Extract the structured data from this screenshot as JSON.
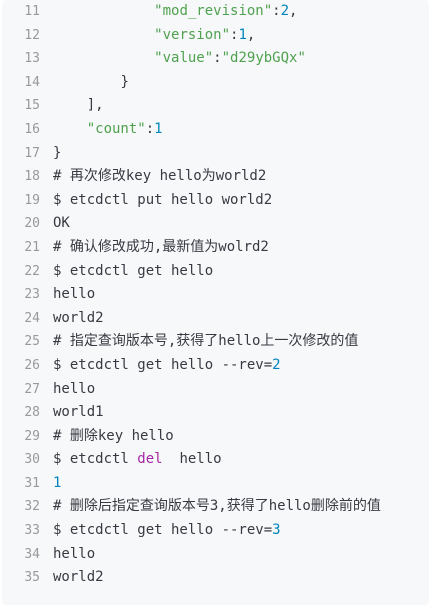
{
  "editor": {
    "colors": {
      "background": "#f6f8fa",
      "line_number": "#999999",
      "plain": "#383a42",
      "string": "#50a14f",
      "number": "#0184bc",
      "keyword": "#a626a4"
    },
    "lines": [
      {
        "number": "11",
        "indent": "            ",
        "tokens": [
          {
            "type": "string",
            "text": "\"mod_revision\""
          },
          {
            "type": "plain",
            "text": ":"
          },
          {
            "type": "number",
            "text": "2"
          },
          {
            "type": "plain",
            "text": ","
          }
        ]
      },
      {
        "number": "12",
        "indent": "            ",
        "tokens": [
          {
            "type": "string",
            "text": "\"version\""
          },
          {
            "type": "plain",
            "text": ":"
          },
          {
            "type": "number",
            "text": "1"
          },
          {
            "type": "plain",
            "text": ","
          }
        ]
      },
      {
        "number": "13",
        "indent": "            ",
        "tokens": [
          {
            "type": "string",
            "text": "\"value\""
          },
          {
            "type": "plain",
            "text": ":"
          },
          {
            "type": "string",
            "text": "\"d29ybGQx\""
          }
        ]
      },
      {
        "number": "14",
        "indent": "        ",
        "tokens": [
          {
            "type": "plain",
            "text": "}"
          }
        ]
      },
      {
        "number": "15",
        "indent": "    ",
        "tokens": [
          {
            "type": "plain",
            "text": "],"
          }
        ]
      },
      {
        "number": "16",
        "indent": "    ",
        "tokens": [
          {
            "type": "string",
            "text": "\"count\""
          },
          {
            "type": "plain",
            "text": ":"
          },
          {
            "type": "number",
            "text": "1"
          }
        ]
      },
      {
        "number": "17",
        "indent": "",
        "tokens": [
          {
            "type": "plain",
            "text": "}"
          }
        ]
      },
      {
        "number": "18",
        "indent": "",
        "tokens": [
          {
            "type": "comment",
            "text": "# 再次修改key hello为world2"
          }
        ]
      },
      {
        "number": "19",
        "indent": "",
        "tokens": [
          {
            "type": "plain",
            "text": "$ etcdctl put hello world2"
          }
        ]
      },
      {
        "number": "20",
        "indent": "",
        "tokens": [
          {
            "type": "plain",
            "text": "OK"
          }
        ]
      },
      {
        "number": "21",
        "indent": "",
        "tokens": [
          {
            "type": "comment",
            "text": "# 确认修改成功,最新值为wolrd2"
          }
        ]
      },
      {
        "number": "22",
        "indent": "",
        "tokens": [
          {
            "type": "plain",
            "text": "$ etcdctl get hello"
          }
        ]
      },
      {
        "number": "23",
        "indent": "",
        "tokens": [
          {
            "type": "plain",
            "text": "hello"
          }
        ]
      },
      {
        "number": "24",
        "indent": "",
        "tokens": [
          {
            "type": "plain",
            "text": "world2"
          }
        ]
      },
      {
        "number": "25",
        "indent": "",
        "tokens": [
          {
            "type": "comment",
            "text": "# 指定查询版本号,获得了hello上一次修改的值"
          }
        ]
      },
      {
        "number": "26",
        "indent": "",
        "tokens": [
          {
            "type": "plain",
            "text": "$ etcdctl get hello --rev="
          },
          {
            "type": "number",
            "text": "2"
          }
        ]
      },
      {
        "number": "27",
        "indent": "",
        "tokens": [
          {
            "type": "plain",
            "text": "hello"
          }
        ]
      },
      {
        "number": "28",
        "indent": "",
        "tokens": [
          {
            "type": "plain",
            "text": "world1"
          }
        ]
      },
      {
        "number": "29",
        "indent": "",
        "tokens": [
          {
            "type": "comment",
            "text": "# 删除key hello"
          }
        ]
      },
      {
        "number": "30",
        "indent": "",
        "tokens": [
          {
            "type": "plain",
            "text": "$ etcdctl "
          },
          {
            "type": "keyword",
            "text": "del"
          },
          {
            "type": "plain",
            "text": "  hello"
          }
        ]
      },
      {
        "number": "31",
        "indent": "",
        "tokens": [
          {
            "type": "number",
            "text": "1"
          }
        ]
      },
      {
        "number": "32",
        "indent": "",
        "tokens": [
          {
            "type": "comment",
            "text": "# 删除后指定查询版本号3,获得了hello删除前的值"
          }
        ]
      },
      {
        "number": "33",
        "indent": "",
        "tokens": [
          {
            "type": "plain",
            "text": "$ etcdctl get hello --rev="
          },
          {
            "type": "number",
            "text": "3"
          }
        ]
      },
      {
        "number": "34",
        "indent": "",
        "tokens": [
          {
            "type": "plain",
            "text": "hello"
          }
        ]
      },
      {
        "number": "35",
        "indent": "",
        "tokens": [
          {
            "type": "plain",
            "text": "world2"
          }
        ]
      }
    ]
  }
}
